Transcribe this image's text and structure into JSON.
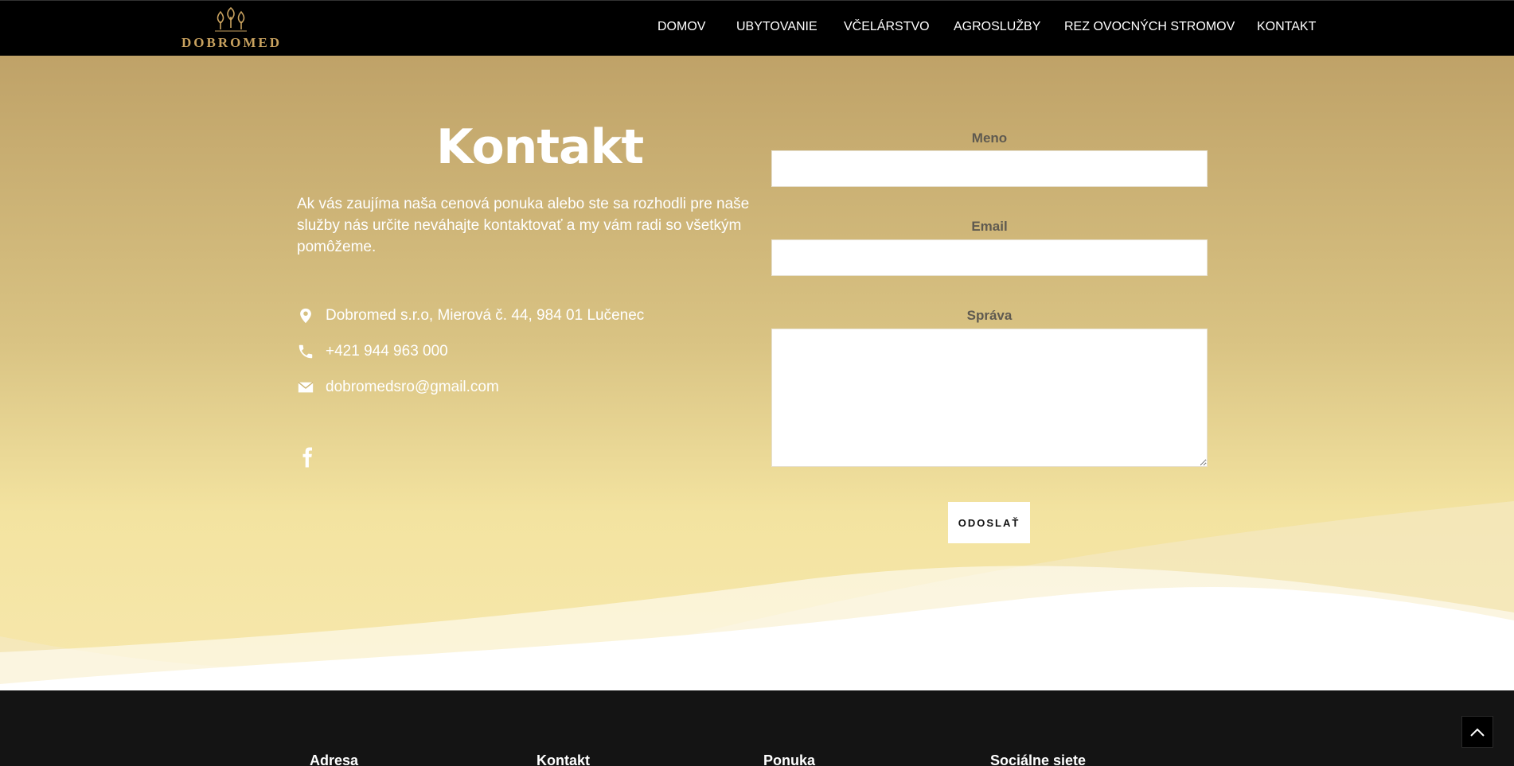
{
  "header": {
    "logo_text": "DOBROMED",
    "nav": [
      {
        "label": "DOMOV"
      },
      {
        "label": "UBYTOVANIE"
      },
      {
        "label": "VČELÁRSTVO"
      },
      {
        "label": "AGROSLUŽBY"
      },
      {
        "label": "REZ OVOCNÝCH STROMOV"
      },
      {
        "label": "KONTAKT"
      }
    ]
  },
  "contact": {
    "title": "Kontakt",
    "lead": "Ak vás zaujíma naša cenová ponuka alebo ste sa rozhodli pre naše služby nás určite neváhajte kontaktovať a my vám radi so všetkým pomôžeme.",
    "address": "Dobromed s.r.o, Mierová č. 44, 984 01 Lučenec",
    "phone": "+421 944 963 000",
    "email": "dobromedsro@gmail.com",
    "icons": {
      "address": "map-marker-icon",
      "phone": "phone-icon",
      "email": "envelope-icon",
      "social": "facebook-icon"
    }
  },
  "form": {
    "name_label": "Meno",
    "email_label": "Email",
    "message_label": "Správa",
    "name_value": "",
    "email_value": "",
    "message_value": "",
    "submit_label": "ODOSLAŤ"
  },
  "footer": {
    "headings": [
      "Adresa",
      "Kontakt",
      "Ponuka",
      "Sociálne siete"
    ]
  },
  "colors": {
    "gold_top": "#bfa268",
    "gold_bottom": "#f7e8ad",
    "logo_gold": "#c9a25f",
    "header_bg": "#000000",
    "footer_bg": "#141414"
  }
}
